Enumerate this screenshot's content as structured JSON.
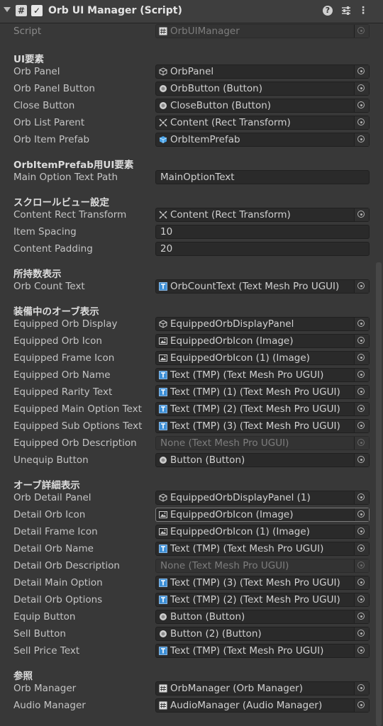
{
  "header": {
    "title": "Orb UI Manager (Script)",
    "enabled": true
  },
  "script_row": {
    "label": "Script",
    "value": "OrbUIManager"
  },
  "sections": [
    {
      "title": "UI要素",
      "rows": [
        {
          "label": "Orb Panel",
          "value": "OrbPanel",
          "icon": "gameobject-icon"
        },
        {
          "label": "Orb Panel Button",
          "value": "OrbButton (Button)",
          "icon": "button-icon"
        },
        {
          "label": "Close Button",
          "value": "CloseButton (Button)",
          "icon": "button-icon"
        },
        {
          "label": "Orb List Parent",
          "value": "Content (Rect Transform)",
          "icon": "recttransform-icon"
        },
        {
          "label": "Orb Item Prefab",
          "value": "OrbItemPrefab",
          "icon": "prefab-icon"
        }
      ]
    },
    {
      "title": "OrbItemPrefab用UI要素",
      "rows": [
        {
          "label": "Main Option Text Path",
          "value": "MainOptionText",
          "icon": "none"
        }
      ]
    },
    {
      "title": "スクロールビュー設定",
      "rows": [
        {
          "label": "Content Rect Transform",
          "value": "Content (Rect Transform)",
          "icon": "recttransform-icon"
        },
        {
          "label": "Item Spacing",
          "value": "10",
          "icon": "none"
        },
        {
          "label": "Content Padding",
          "value": "20",
          "icon": "none"
        }
      ]
    },
    {
      "title": "所持数表示",
      "rows": [
        {
          "label": "Orb Count Text",
          "value": "OrbCountText (Text Mesh Pro UGUI)",
          "icon": "tmp-icon"
        }
      ]
    },
    {
      "title": "装備中のオーブ表示",
      "rows": [
        {
          "label": "Equipped Orb Display",
          "value": "EquippedOrbDisplayPanel",
          "icon": "gameobject-icon"
        },
        {
          "label": "Equipped Orb Icon",
          "value": "EquippedOrbIcon (Image)",
          "icon": "image-icon"
        },
        {
          "label": "Equipped Frame Icon",
          "value": "EquippedOrbIcon (1) (Image)",
          "icon": "image-icon"
        },
        {
          "label": "Equipped Orb Name",
          "value": "Text (TMP) (Text Mesh Pro UGUI)",
          "icon": "tmp-icon"
        },
        {
          "label": "Equipped Rarity Text",
          "value": "Text (TMP) (1) (Text Mesh Pro UGUI)",
          "icon": "tmp-icon"
        },
        {
          "label": "Equipped Main Option Text",
          "value": "Text (TMP) (2) (Text Mesh Pro UGUI)",
          "icon": "tmp-icon"
        },
        {
          "label": "Equipped Sub Options Text",
          "value": "Text (TMP) (3) (Text Mesh Pro UGUI)",
          "icon": "tmp-icon"
        },
        {
          "label": "Equipped Orb Description",
          "value": "None (Text Mesh Pro UGUI)",
          "icon": "none-ref"
        },
        {
          "label": "Unequip Button",
          "value": "Button (Button)",
          "icon": "button-icon"
        }
      ]
    },
    {
      "title": "オーブ詳細表示",
      "rows": [
        {
          "label": "Orb Detail Panel",
          "value": "EquippedOrbDisplayPanel (1)",
          "icon": "gameobject-icon"
        },
        {
          "label": "Detail Orb Icon",
          "value": "EquippedOrbIcon (Image)",
          "icon": "image-icon"
        },
        {
          "label": "Detail Frame Icon",
          "value": "EquippedOrbIcon (1) (Image)",
          "icon": "image-icon"
        },
        {
          "label": "Detail Orb Name",
          "value": "Text (TMP) (Text Mesh Pro UGUI)",
          "icon": "tmp-icon"
        },
        {
          "label": "Detail Orb Description",
          "value": "None (Text Mesh Pro UGUI)",
          "icon": "none-ref"
        },
        {
          "label": "Detail Main Option",
          "value": "Text (TMP) (3) (Text Mesh Pro UGUI)",
          "icon": "tmp-icon"
        },
        {
          "label": "Detail Orb Options",
          "value": "Text (TMP) (2) (Text Mesh Pro UGUI)",
          "icon": "tmp-icon"
        },
        {
          "label": "Equip Button",
          "value": "Button (Button)",
          "icon": "button-icon"
        },
        {
          "label": "Sell Button",
          "value": "Button (2) (Button)",
          "icon": "button-icon"
        },
        {
          "label": "Sell Price Text",
          "value": "Text (TMP) (Text Mesh Pro UGUI)",
          "icon": "tmp-icon"
        }
      ]
    },
    {
      "title": "参照",
      "rows": [
        {
          "label": "Orb Manager",
          "value": "OrbManager (Orb Manager)",
          "icon": "script-icon"
        },
        {
          "label": "Audio Manager",
          "value": "AudioManager (Audio Manager)",
          "icon": "script-icon"
        }
      ]
    }
  ]
}
